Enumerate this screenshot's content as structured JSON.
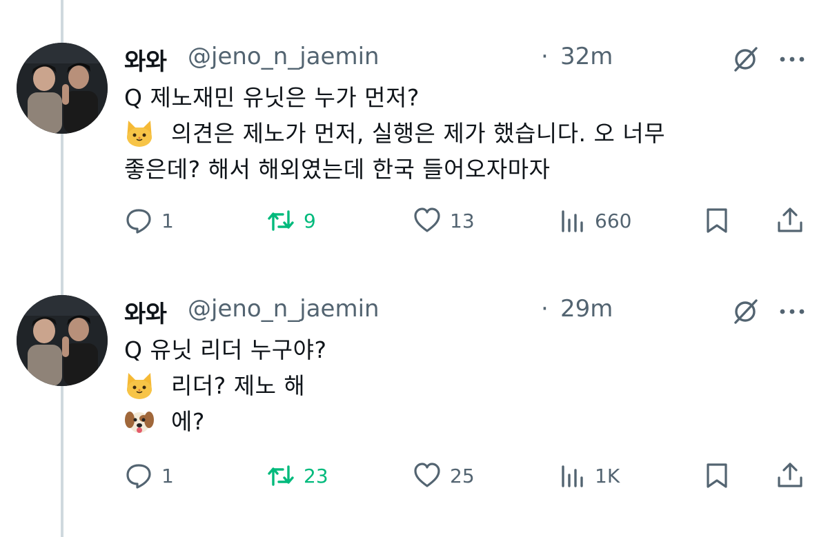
{
  "colors": {
    "muted": "#536471",
    "retweet_green": "#00ba7c",
    "thread_line": "#cfd9de"
  },
  "tweets": [
    {
      "author": "와와",
      "handle": "@jeno_n_jaemin",
      "separator": "·",
      "time": "32m",
      "lines": [
        {
          "emoji": "",
          "text": "Q 제노재민 유닛은 누가 먼저?"
        },
        {
          "emoji": "cat-face-emoji",
          "text": "의견은 제노가 먼저, 실행은 제가 했습니다. 오 너무"
        },
        {
          "emoji": "",
          "text": "좋은데? 해서 해외였는데 한국 들어오자마자"
        }
      ],
      "replies": "1",
      "retweets": "9",
      "likes": "13",
      "views": "660"
    },
    {
      "author": "와와",
      "handle": "@jeno_n_jaemin",
      "separator": "·",
      "time": "29m",
      "lines": [
        {
          "emoji": "",
          "text": "Q 유닛 리더 누구야?"
        },
        {
          "emoji": "cat-face-emoji",
          "text": "리더? 제노 해"
        },
        {
          "emoji": "dog-face-emoji",
          "text": "에?"
        }
      ],
      "replies": "1",
      "retweets": "23",
      "likes": "25",
      "views": "1K"
    }
  ]
}
